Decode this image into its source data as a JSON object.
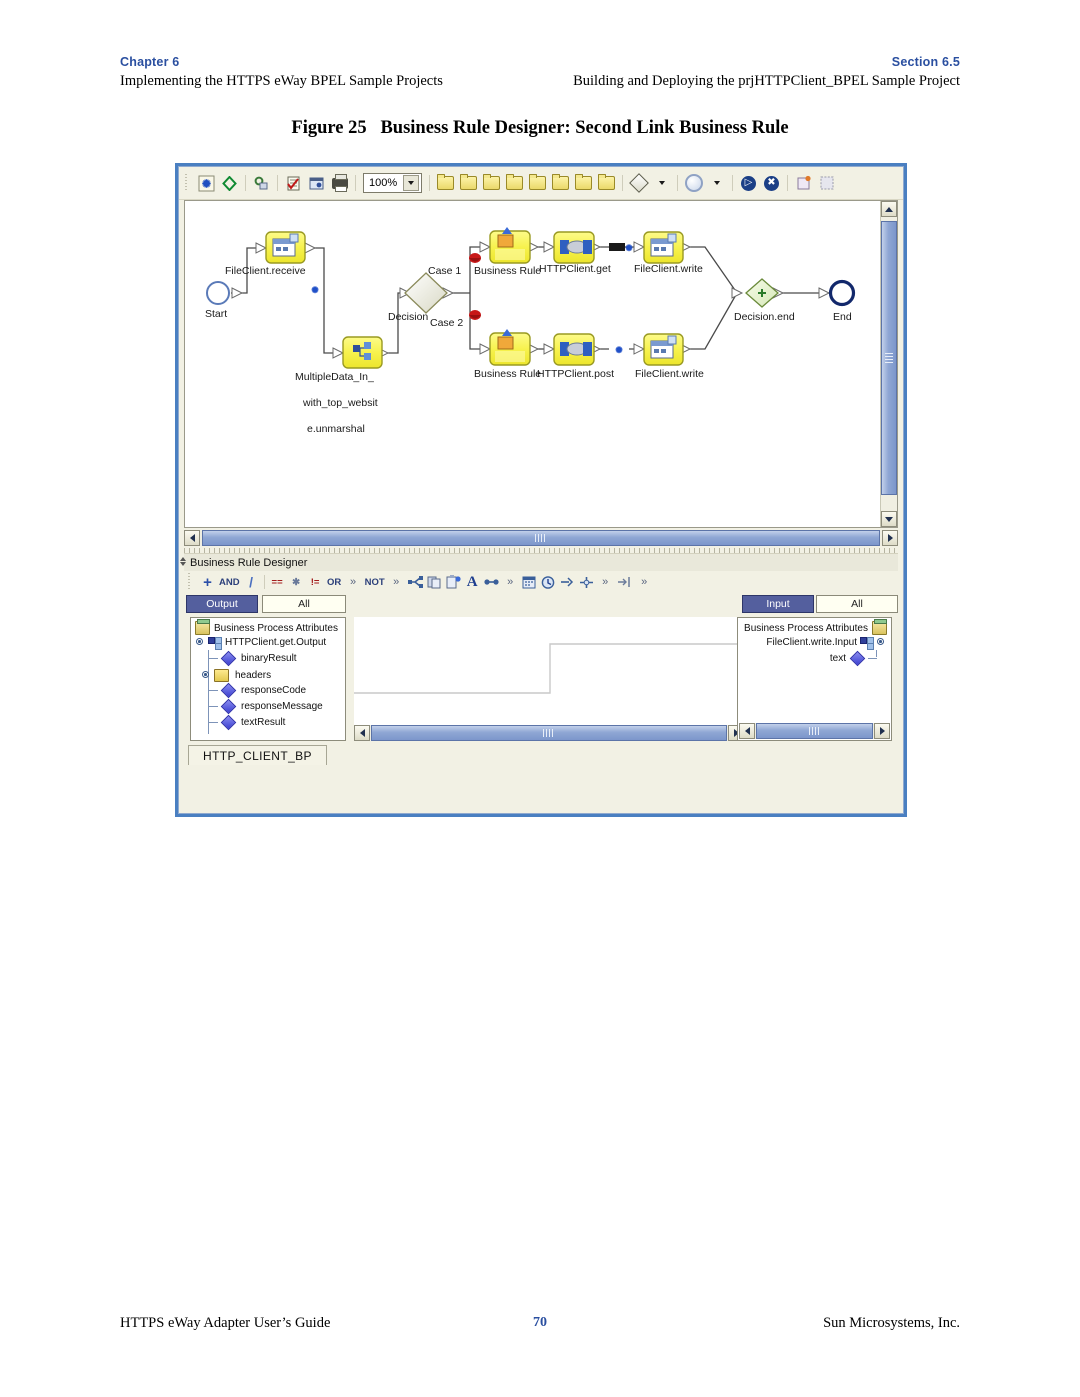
{
  "page_header": {
    "left_kicker": "Chapter 6",
    "left_sub": "Implementing the HTTPS eWay BPEL Sample Projects",
    "right_kicker": "Section 6.5",
    "right_sub": "Building and Deploying the prjHTTPClient_BPEL Sample Project"
  },
  "figure": {
    "number": "Figure 25",
    "caption": "Business Rule Designer: Second Link Business Rule"
  },
  "app": {
    "toolbar": {
      "zoom_value": "100%",
      "icons": [
        "bpel-map-icon",
        "diamond-outline-icon",
        "link-chain-icon",
        "validate-checklist-icon",
        "properties-icon",
        "print-icon"
      ],
      "palette_icons": [
        "activity-folder-icon",
        "plain-folder-icon",
        "assign-folder-icon",
        "invoke-folder-icon",
        "while-folder-icon",
        "scope-folder-icon",
        "receive-folder-icon",
        "reply-folder-icon"
      ],
      "shape_icons": [
        "decision-diamond-icon",
        "circle-event-icon"
      ],
      "nav_icons": [
        "start-event-icon",
        "end-event-icon"
      ],
      "layout_icons": [
        "auto-layout-icon",
        "fit-page-icon"
      ]
    },
    "canvas": {
      "nodes": [
        {
          "id": "start",
          "label": "Start",
          "type": "start-event"
        },
        {
          "id": "receive",
          "label": "FileClient.receive",
          "type": "receive-activity"
        },
        {
          "id": "unmarshal",
          "label": "MultipleData_In_",
          "label2": "with_top_websit",
          "label3": "e.unmarshal",
          "type": "otd-activity"
        },
        {
          "id": "decision",
          "label": "Decision",
          "type": "decision-gate"
        },
        {
          "id": "case1",
          "label": "Case 1",
          "type": "case-branch"
        },
        {
          "id": "case2",
          "label": "Case 2",
          "type": "case-branch"
        },
        {
          "id": "rule1",
          "label": "Business Rule",
          "type": "business-rule"
        },
        {
          "id": "get",
          "label": "HTTPClient.get",
          "type": "invoke-activity"
        },
        {
          "id": "write1",
          "label": "FileClient.write",
          "type": "write-activity"
        },
        {
          "id": "rule2",
          "label": "Business Rule",
          "type": "business-rule"
        },
        {
          "id": "post",
          "label": "HTTPClient.post",
          "type": "invoke-activity"
        },
        {
          "id": "write2",
          "label": "FileClient.write",
          "type": "write-activity"
        },
        {
          "id": "decisionend",
          "label": "Decision.end",
          "type": "merge-gate"
        },
        {
          "id": "end",
          "label": "End",
          "type": "end-event"
        }
      ]
    },
    "business_rule_designer": {
      "title": "Business Rule Designer",
      "toolbar_items": [
        "add-icon",
        "AND",
        "divide-icon",
        "==",
        "not-equal-icon",
        "!=",
        "OR",
        "»",
        "NOT",
        "»",
        "branch-icon",
        "copy-icon",
        "paste-icon",
        "A",
        "link-icon",
        "»",
        "calendar-icon",
        "clock-icon",
        "duration-icon",
        "merge-icon",
        "»",
        "indent-icon",
        "»"
      ],
      "output_button": "Output",
      "output_filter": "All",
      "input_button": "Input",
      "input_filter": "All",
      "output_tree": {
        "root": "Business Process Attributes",
        "node": "HTTPClient.get.Output",
        "children": [
          {
            "label": "binaryResult",
            "icon": "attribute-diamond-icon"
          },
          {
            "label": "headers",
            "icon": "node-folder-icon"
          },
          {
            "label": "responseCode",
            "icon": "attribute-diamond-icon"
          },
          {
            "label": "responseMessage",
            "icon": "attribute-diamond-icon"
          },
          {
            "label": "textResult",
            "icon": "attribute-diamond-icon"
          }
        ]
      },
      "input_tree": {
        "root": "Business Process Attributes",
        "node": "FileClient.write.Input",
        "children": [
          {
            "label": "text",
            "icon": "attribute-diamond-icon"
          }
        ]
      }
    },
    "bottom_tab": "HTTP_CLIENT_BP"
  },
  "page_footer": {
    "left": "HTTPS eWay Adapter User’s Guide",
    "center": "70",
    "right": "Sun Microsystems, Inc."
  },
  "colors": {
    "accent_blue": "#2a4fa0",
    "window_frame": "#4a7fc1",
    "node_yellow": "#f5ef5a",
    "selected_button": "#545f9e"
  }
}
